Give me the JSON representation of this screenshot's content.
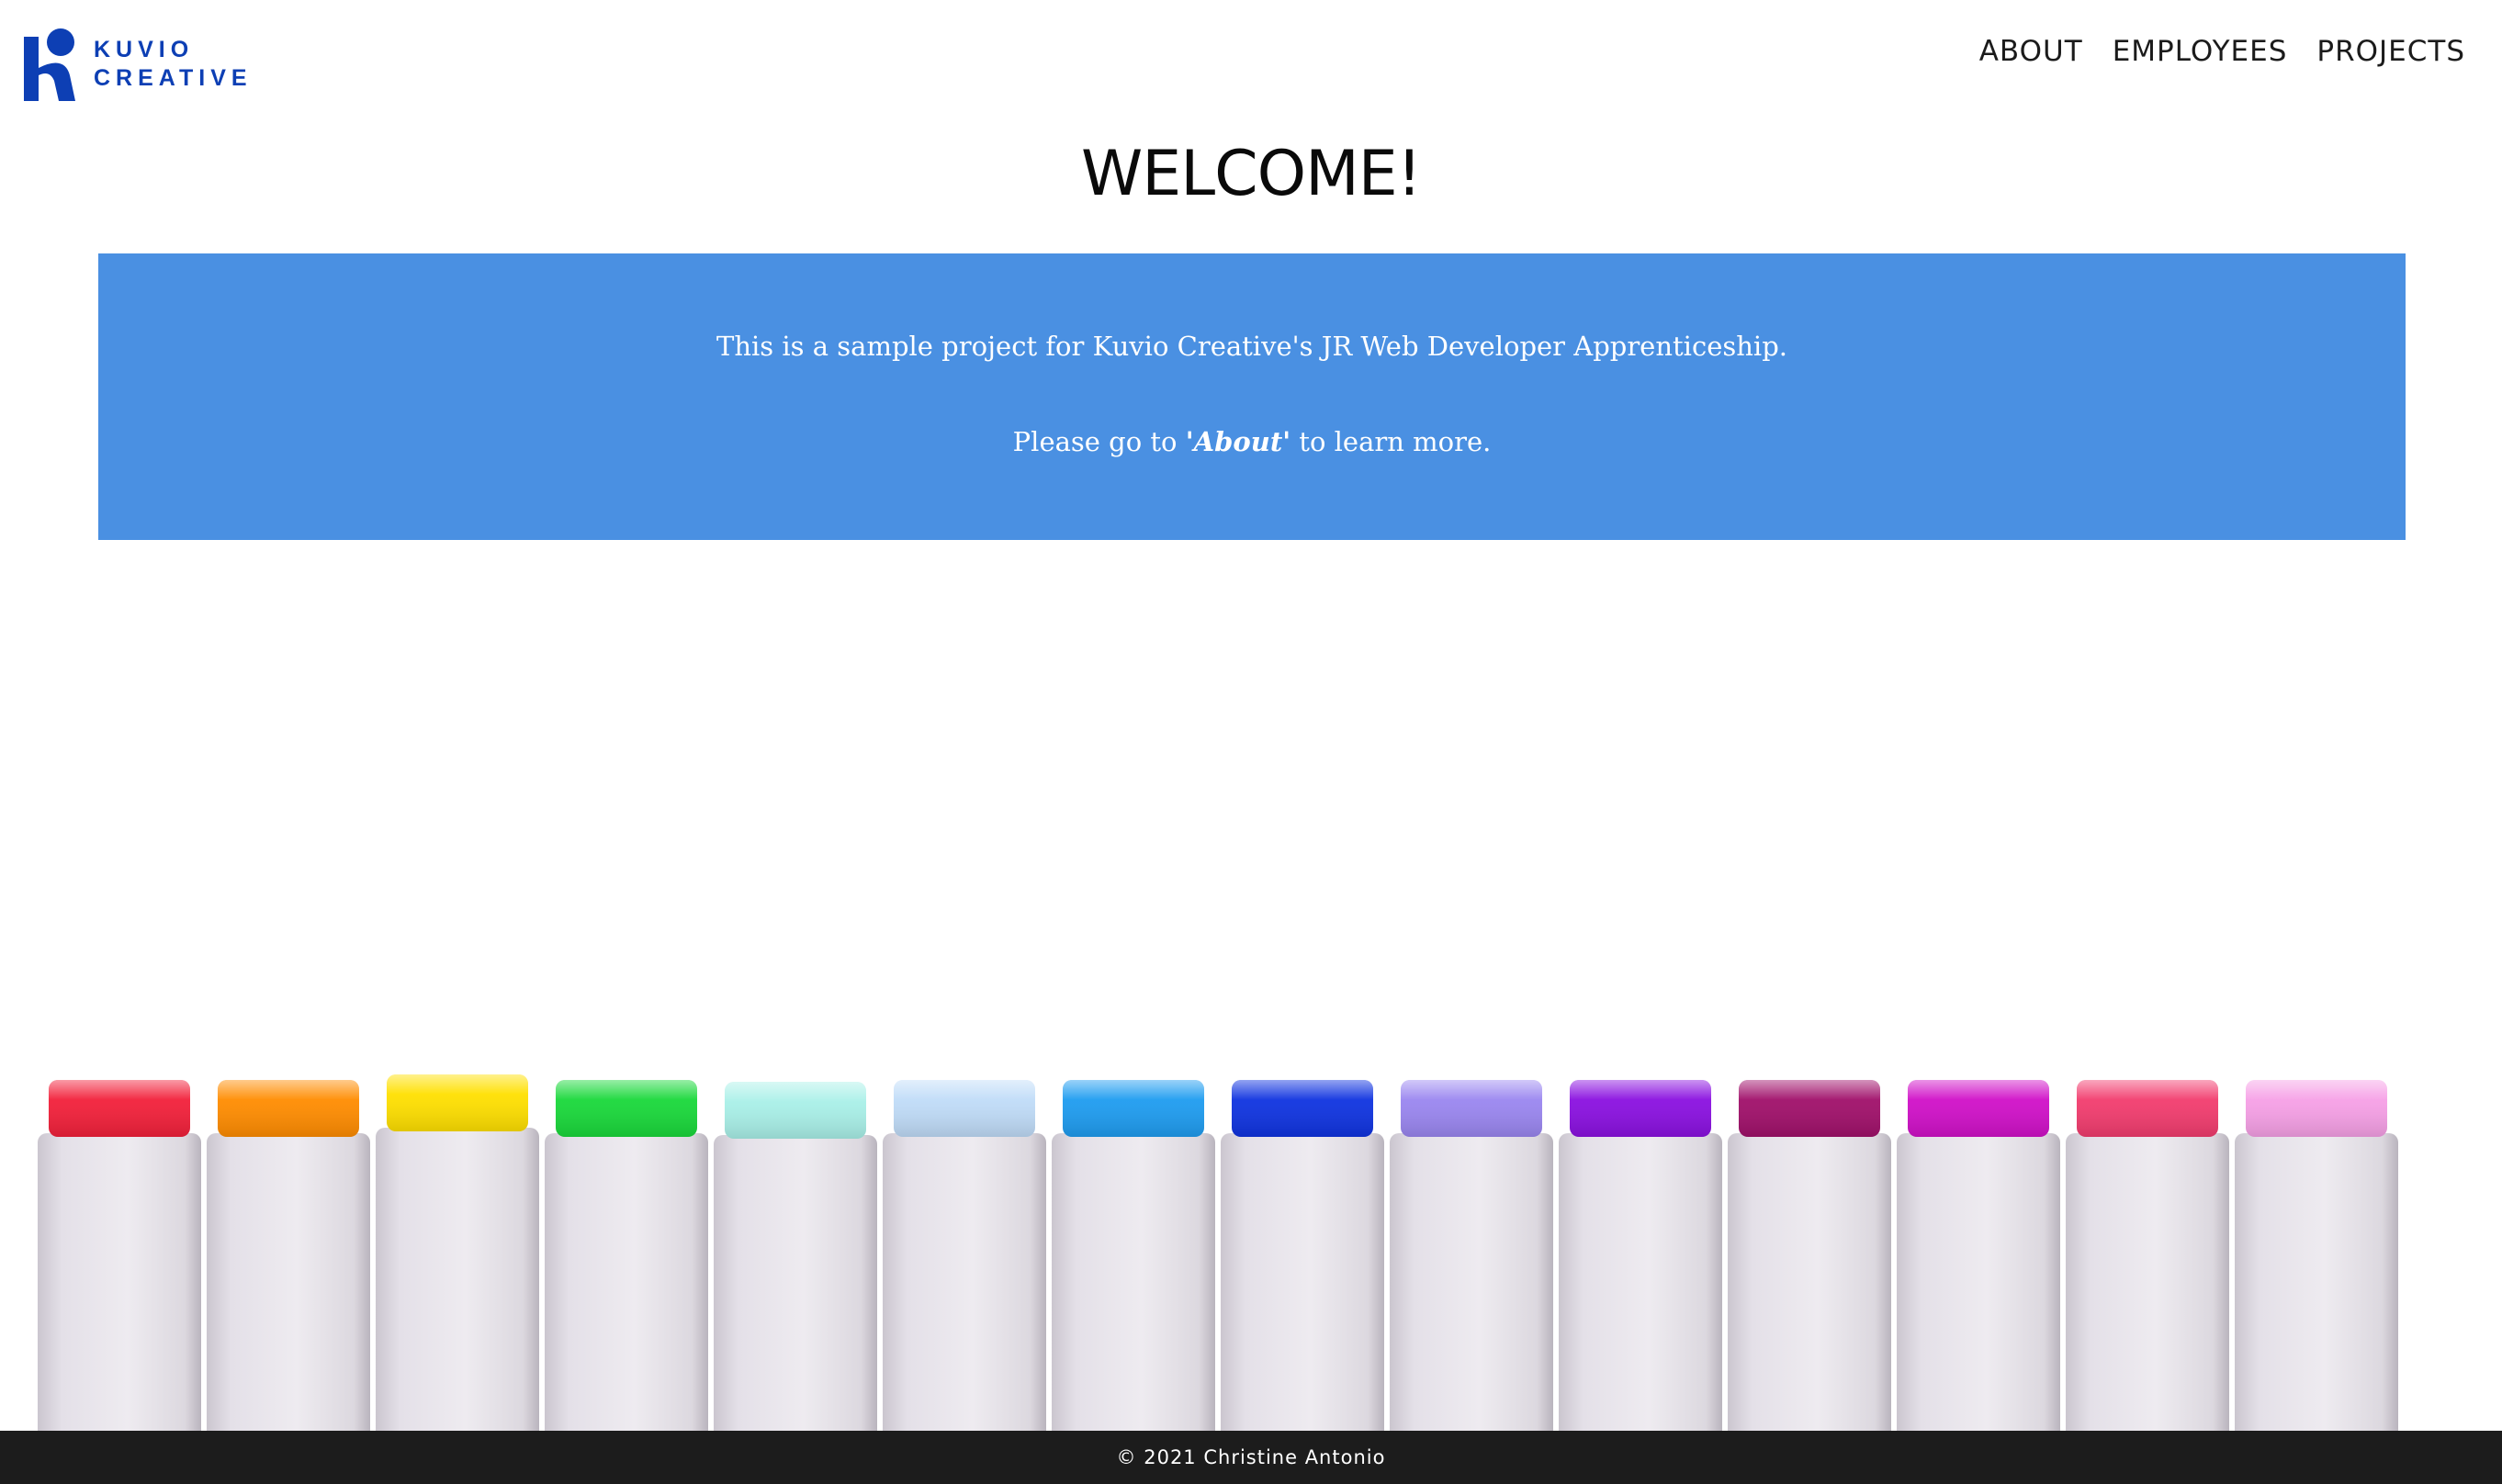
{
  "header": {
    "logo": {
      "line1": "KUVIO",
      "line2": "CREATIVE",
      "color": "#0d3fb4"
    },
    "nav": [
      {
        "label": "ABOUT"
      },
      {
        "label": "EMPLOYEES"
      },
      {
        "label": "PROJECTS"
      }
    ]
  },
  "main": {
    "title": "WELCOME!",
    "banner": {
      "background": "#4a90e2",
      "line1": "This is a sample project for Kuvio Creative's JR Web Developer Apprenticeship.",
      "line2_before": "Please go to ",
      "line2_link": "'About'",
      "line2_after": " to learn more."
    },
    "hero_image": {
      "marker_cap_colors": [
        "#f2203a",
        "#ff8c00",
        "#ffe000",
        "#19d83a",
        "#a9f0e8",
        "#c0dcf8",
        "#1e9cf0",
        "#0f33e0",
        "#9a86f0",
        "#8a10e0",
        "#a0106a",
        "#d010c8",
        "#f23c6e",
        "#f6a0e6"
      ]
    }
  },
  "footer": {
    "copyright": "© 2021 Christine Antonio"
  }
}
